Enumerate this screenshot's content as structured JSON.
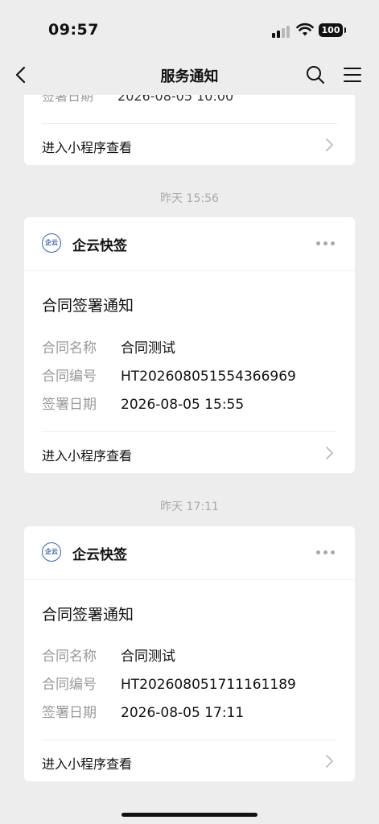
{
  "status": {
    "time": "09:57",
    "battery": "100"
  },
  "nav": {
    "title": "服务通知"
  },
  "partial": {
    "label": "签署日期",
    "value": "2026-08-05 10:00",
    "link": "进入小程序查看"
  },
  "messages": [
    {
      "timestamp": "昨天 15:56",
      "sender": "企云快签",
      "logo_text": "企云",
      "title": "合同签署通知",
      "fields": [
        {
          "label": "合同名称",
          "value": "合同测试"
        },
        {
          "label": "合同编号",
          "value": "HT202608051554366969"
        },
        {
          "label": "签署日期",
          "value": "2026-08-05 15:55"
        }
      ],
      "link": "进入小程序查看"
    },
    {
      "timestamp": "昨天 17:11",
      "sender": "企云快签",
      "logo_text": "企云",
      "title": "合同签署通知",
      "fields": [
        {
          "label": "合同名称",
          "value": "合同测试"
        },
        {
          "label": "合同编号",
          "value": "HT202608051711161189"
        },
        {
          "label": "签署日期",
          "value": "2026-08-05 17:11"
        }
      ],
      "link": "进入小程序查看"
    }
  ]
}
